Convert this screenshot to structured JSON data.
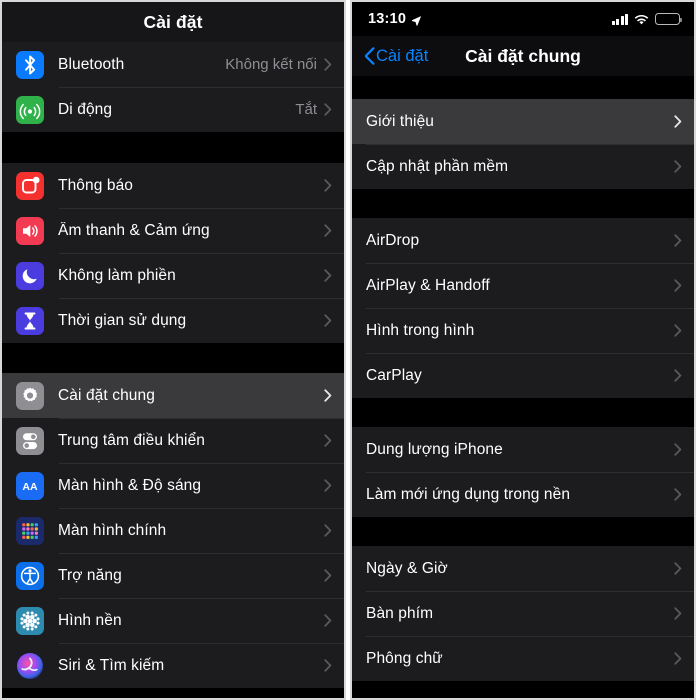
{
  "left_screen": {
    "nav_title": "Cài đặt",
    "sections": [
      {
        "rows": [
          {
            "label": "Bluetooth",
            "value": "Không kết nối",
            "icon": "bluetooth-icon",
            "icon_bg": "#0a7aff",
            "selected": false
          },
          {
            "label": "Di động",
            "value": "Tắt",
            "icon": "cellular-icon",
            "icon_bg": "#30b24a",
            "selected": false
          }
        ]
      },
      {
        "rows": [
          {
            "label": "Thông báo",
            "value": "",
            "icon": "notifications-icon",
            "icon_bg": "#f4312f",
            "selected": false
          },
          {
            "label": "Âm thanh & Cảm ứng",
            "value": "",
            "icon": "sounds-icon",
            "icon_bg": "#f23b52",
            "selected": false
          },
          {
            "label": "Không làm phiền",
            "value": "",
            "icon": "do-not-disturb-icon",
            "icon_bg": "#4b3ce0",
            "selected": false
          },
          {
            "label": "Thời gian sử dụng",
            "value": "",
            "icon": "screen-time-icon",
            "icon_bg": "#4b3ce0",
            "selected": false
          }
        ]
      },
      {
        "rows": [
          {
            "label": "Cài đặt chung",
            "value": "",
            "icon": "gear-icon",
            "icon_bg": "#8e8e93",
            "selected": true
          },
          {
            "label": "Trung tâm điều khiển",
            "value": "",
            "icon": "control-center-icon",
            "icon_bg": "#8e8e93",
            "selected": false
          },
          {
            "label": "Màn hình & Độ sáng",
            "value": "",
            "icon": "display-brightness-icon",
            "icon_bg": "#1a6cf5",
            "selected": false
          },
          {
            "label": "Màn hình chính",
            "value": "",
            "icon": "home-screen-icon",
            "icon_bg": "#1a2a6b",
            "selected": false
          },
          {
            "label": "Trợ năng",
            "value": "",
            "icon": "accessibility-icon",
            "icon_bg": "#0a6fe8",
            "selected": false
          },
          {
            "label": "Hình nền",
            "value": "",
            "icon": "wallpaper-icon",
            "icon_bg": "#2e8bb0",
            "selected": false
          },
          {
            "label": "Siri & Tìm kiếm",
            "value": "",
            "icon": "siri-icon",
            "icon_bg": "#1b1b24",
            "selected": false
          }
        ]
      }
    ]
  },
  "right_screen": {
    "status_bar": {
      "time": "13:10",
      "location_icon": "location-arrow-icon",
      "signal_icon": "cellular-bars-icon",
      "wifi_icon": "wifi-icon",
      "battery_icon": "battery-low-icon",
      "battery_level_percent": 18,
      "battery_color": "#ff3b30"
    },
    "back_label": "Cài đặt",
    "nav_title": "Cài đặt chung",
    "sections": [
      {
        "rows": [
          {
            "label": "Giới thiệu",
            "selected": true
          },
          {
            "label": "Cập nhật phần mềm",
            "selected": false
          }
        ]
      },
      {
        "rows": [
          {
            "label": "AirDrop",
            "selected": false
          },
          {
            "label": "AirPlay & Handoff",
            "selected": false
          },
          {
            "label": "Hình trong hình",
            "selected": false
          },
          {
            "label": "CarPlay",
            "selected": false
          }
        ]
      },
      {
        "rows": [
          {
            "label": "Dung lượng iPhone",
            "selected": false
          },
          {
            "label": "Làm mới ứng dụng trong nền",
            "selected": false
          }
        ]
      },
      {
        "rows": [
          {
            "label": "Ngày & Giờ",
            "selected": false
          },
          {
            "label": "Bàn phím",
            "selected": false
          },
          {
            "label": "Phông chữ",
            "selected": false
          }
        ]
      }
    ]
  },
  "colors": {
    "accent_blue": "#0a84ff",
    "row_bg": "#1c1c1e",
    "row_selected_bg": "#3a3a3c",
    "page_bg": "#000000",
    "secondary_text": "#8e8e93"
  }
}
